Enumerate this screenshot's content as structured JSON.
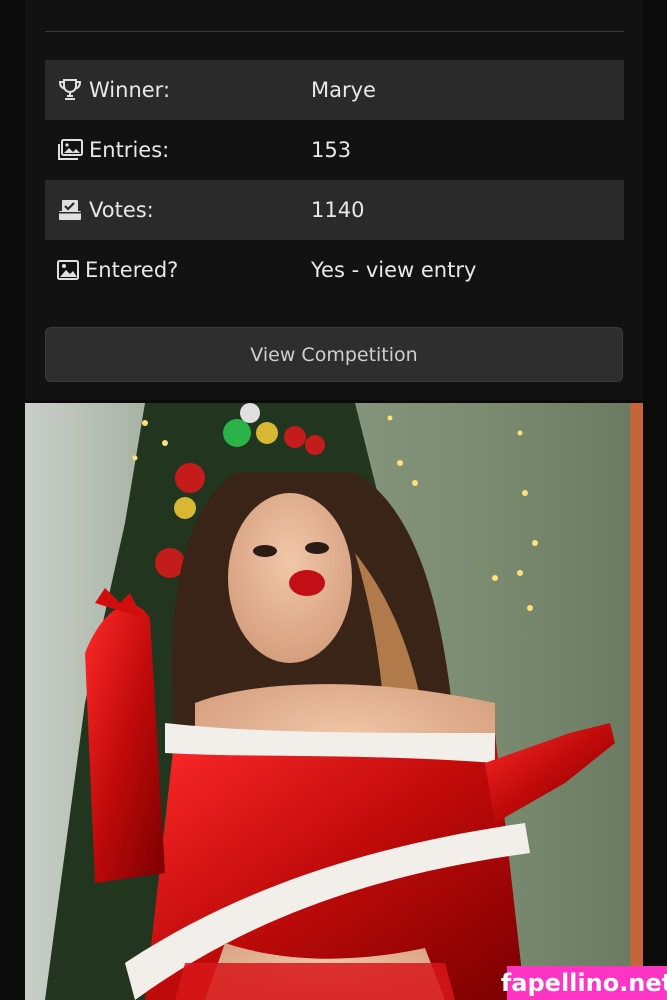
{
  "stats": {
    "winner": {
      "label": "Winner:",
      "value": "Marye",
      "icon": "trophy-icon"
    },
    "entries": {
      "label": "Entries:",
      "value": "153",
      "icon": "images-icon"
    },
    "votes": {
      "label": "Votes:",
      "value": "1140",
      "icon": "ballot-box-icon"
    },
    "entered": {
      "label": "Entered?",
      "value": "Yes - view entry",
      "icon": "image-icon"
    }
  },
  "actions": {
    "view_competition": "View Competition"
  },
  "watermark": "fapellino.net",
  "colors": {
    "background": "#0b0b0b",
    "row_shaded": "#2a2a2a",
    "button": "#2e2e2e",
    "watermark_bg": "#ff33c4",
    "text": "#e8e8e8"
  }
}
